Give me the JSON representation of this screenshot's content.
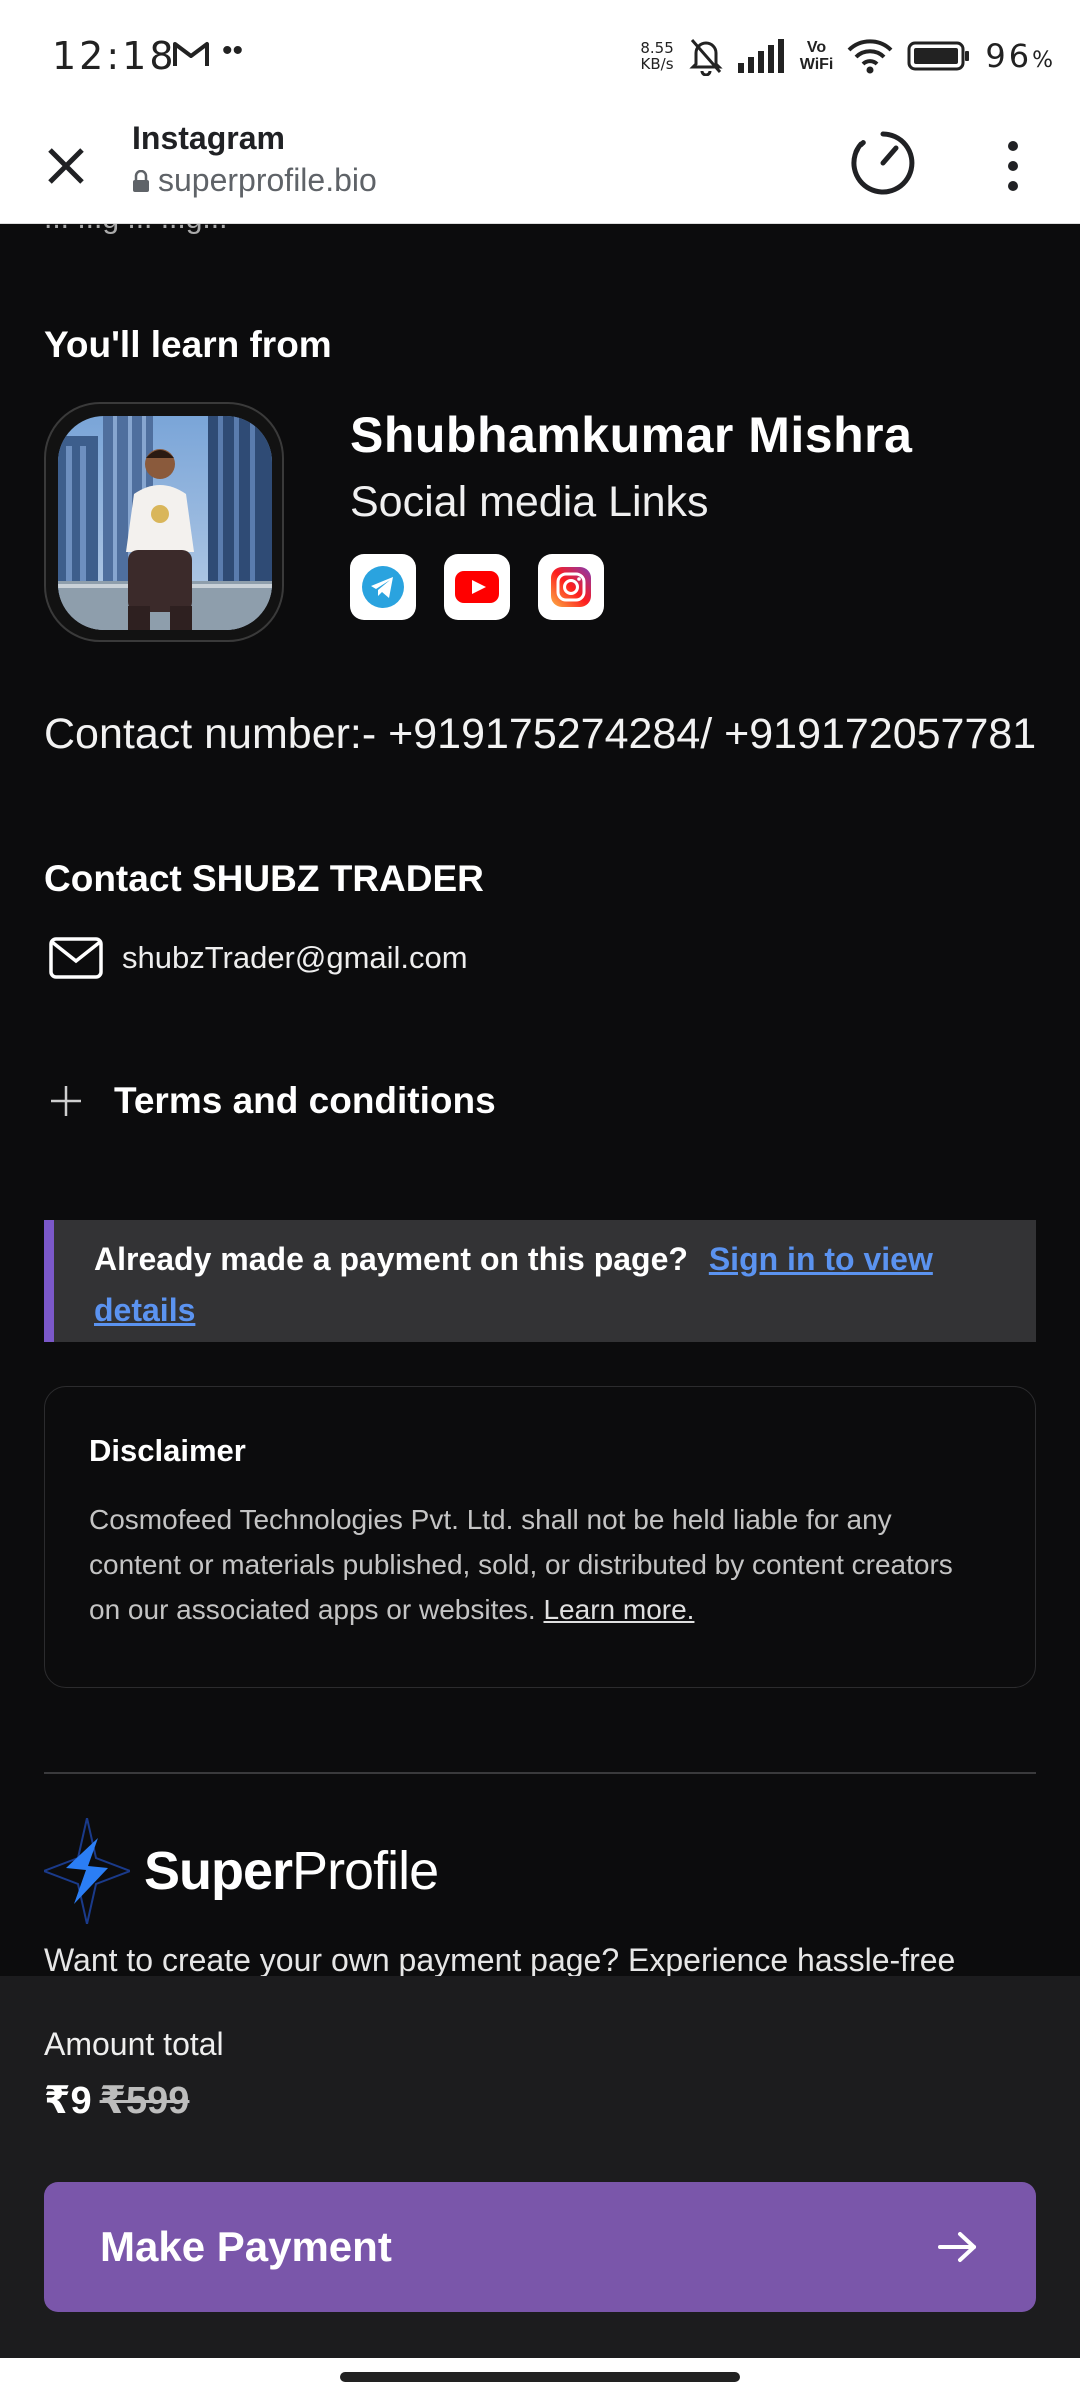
{
  "status_bar": {
    "time": "12:18",
    "net_speed_value": "8.55",
    "net_speed_unit": "KB/s",
    "battery_percent": "96",
    "battery_unit": "%",
    "vowifi_top": "Vo",
    "vowifi_bottom": "WiFi"
  },
  "browser": {
    "title": "Instagram",
    "url": "superprofile.bio"
  },
  "page": {
    "top_cut_text": "... ...g ... ...g...",
    "learn_heading": "You'll learn from",
    "creator": {
      "name": "Shubhamkumar Mishra",
      "subtitle": "Social media Links"
    },
    "social_icons": [
      "telegram-icon",
      "youtube-icon",
      "instagram-icon"
    ],
    "contact_number": "Contact number:- +919175274284/ +919172057781",
    "contact_heading": "Contact SHUBZ TRADER",
    "email": "shubzTrader@gmail.com",
    "terms_label": "Terms and conditions",
    "payment_notice": {
      "text": "Already made a payment on this page?",
      "link": "Sign in to view details"
    },
    "disclaimer": {
      "title": "Disclaimer",
      "text": "Cosmofeed Technologies Pvt. Ltd. shall not be held liable for any content or materials published, sold, or distributed by content creators on our associated apps or websites.",
      "link": "Learn more."
    },
    "brand": {
      "name_bold": "Super",
      "name_regular": "Profile",
      "promo": "Want to create your own payment page? Experience hassle-free"
    }
  },
  "footer": {
    "amount_label": "Amount total",
    "price": "₹9",
    "original_price": "₹599",
    "button_label": "Make Payment"
  },
  "colors": {
    "background": "#0c0c0d",
    "accent_purple": "#7a56aa",
    "link_blue": "#5b93f0"
  }
}
